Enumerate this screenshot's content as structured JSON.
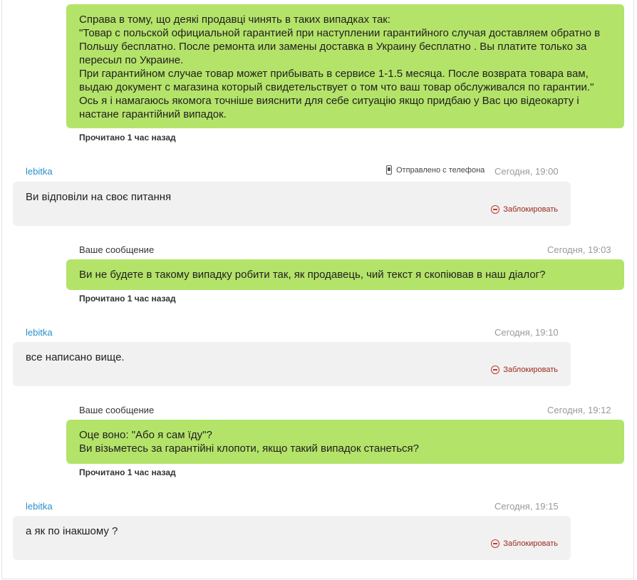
{
  "messages": {
    "m1": {
      "lines": [
        "Справа в тому, що деякі продавці чинять в таких випадках так:",
        "\"Товар с польской официальной гарантией при наступлении гарантийного случая доставляем обратно в",
        "Польшу бесплатно. После ремонта или замены доставка в Украину бесплатно . Вы платите только за",
        "пересыл по Украине.",
        "При гарантийном случае товар может прибывать в сервисе 1-1.5 месяца. После возврата товара вам,",
        "выдаю документ с магазина который свидетельствует о том что ваш товар обслуживался по гарантии.\"",
        "Ось я і намагаюсь якомога точніше вияснити для себе ситуацію якщо придбаю у Вас цю відеокарту і",
        "настане гарантійний випадок."
      ],
      "status": "Прочитано 1 час назад"
    },
    "m2": {
      "sender": "lebitka",
      "via": "Отправлено с телефона",
      "time": "Сегодня, 19:00",
      "text": "Ви відповіли на своє питання",
      "block": "Заблокировать"
    },
    "m3": {
      "label": "Ваше сообщение",
      "time": "Сегодня, 19:03",
      "lines": [
        "Ви не будете в такому випадку робити так, як продавець, чий текст я скопіював в наш діалог?"
      ],
      "status": "Прочитано 1 час назад"
    },
    "m4": {
      "sender": "lebitka",
      "time": "Сегодня, 19:10",
      "text": "все написано вище.",
      "block": "Заблокировать"
    },
    "m5": {
      "label": "Ваше сообщение",
      "time": "Сегодня, 19:12",
      "lines": [
        "Оце воно: \"Або я сам їду\"?",
        "Ви візьметесь за гарантійні клопоти, якщо такий випадок станеться?"
      ],
      "status": "Прочитано 1 час назад"
    },
    "m6": {
      "sender": "lebitka",
      "time": "Сегодня, 19:15",
      "text": "а як по інакшому ?",
      "block": "Заблокировать"
    }
  },
  "colors": {
    "outgoing_bubble": "#b4e369",
    "incoming_bubble": "#f1f1f1",
    "sender_link": "#2a8fc8",
    "block_red": "#c0392b"
  }
}
